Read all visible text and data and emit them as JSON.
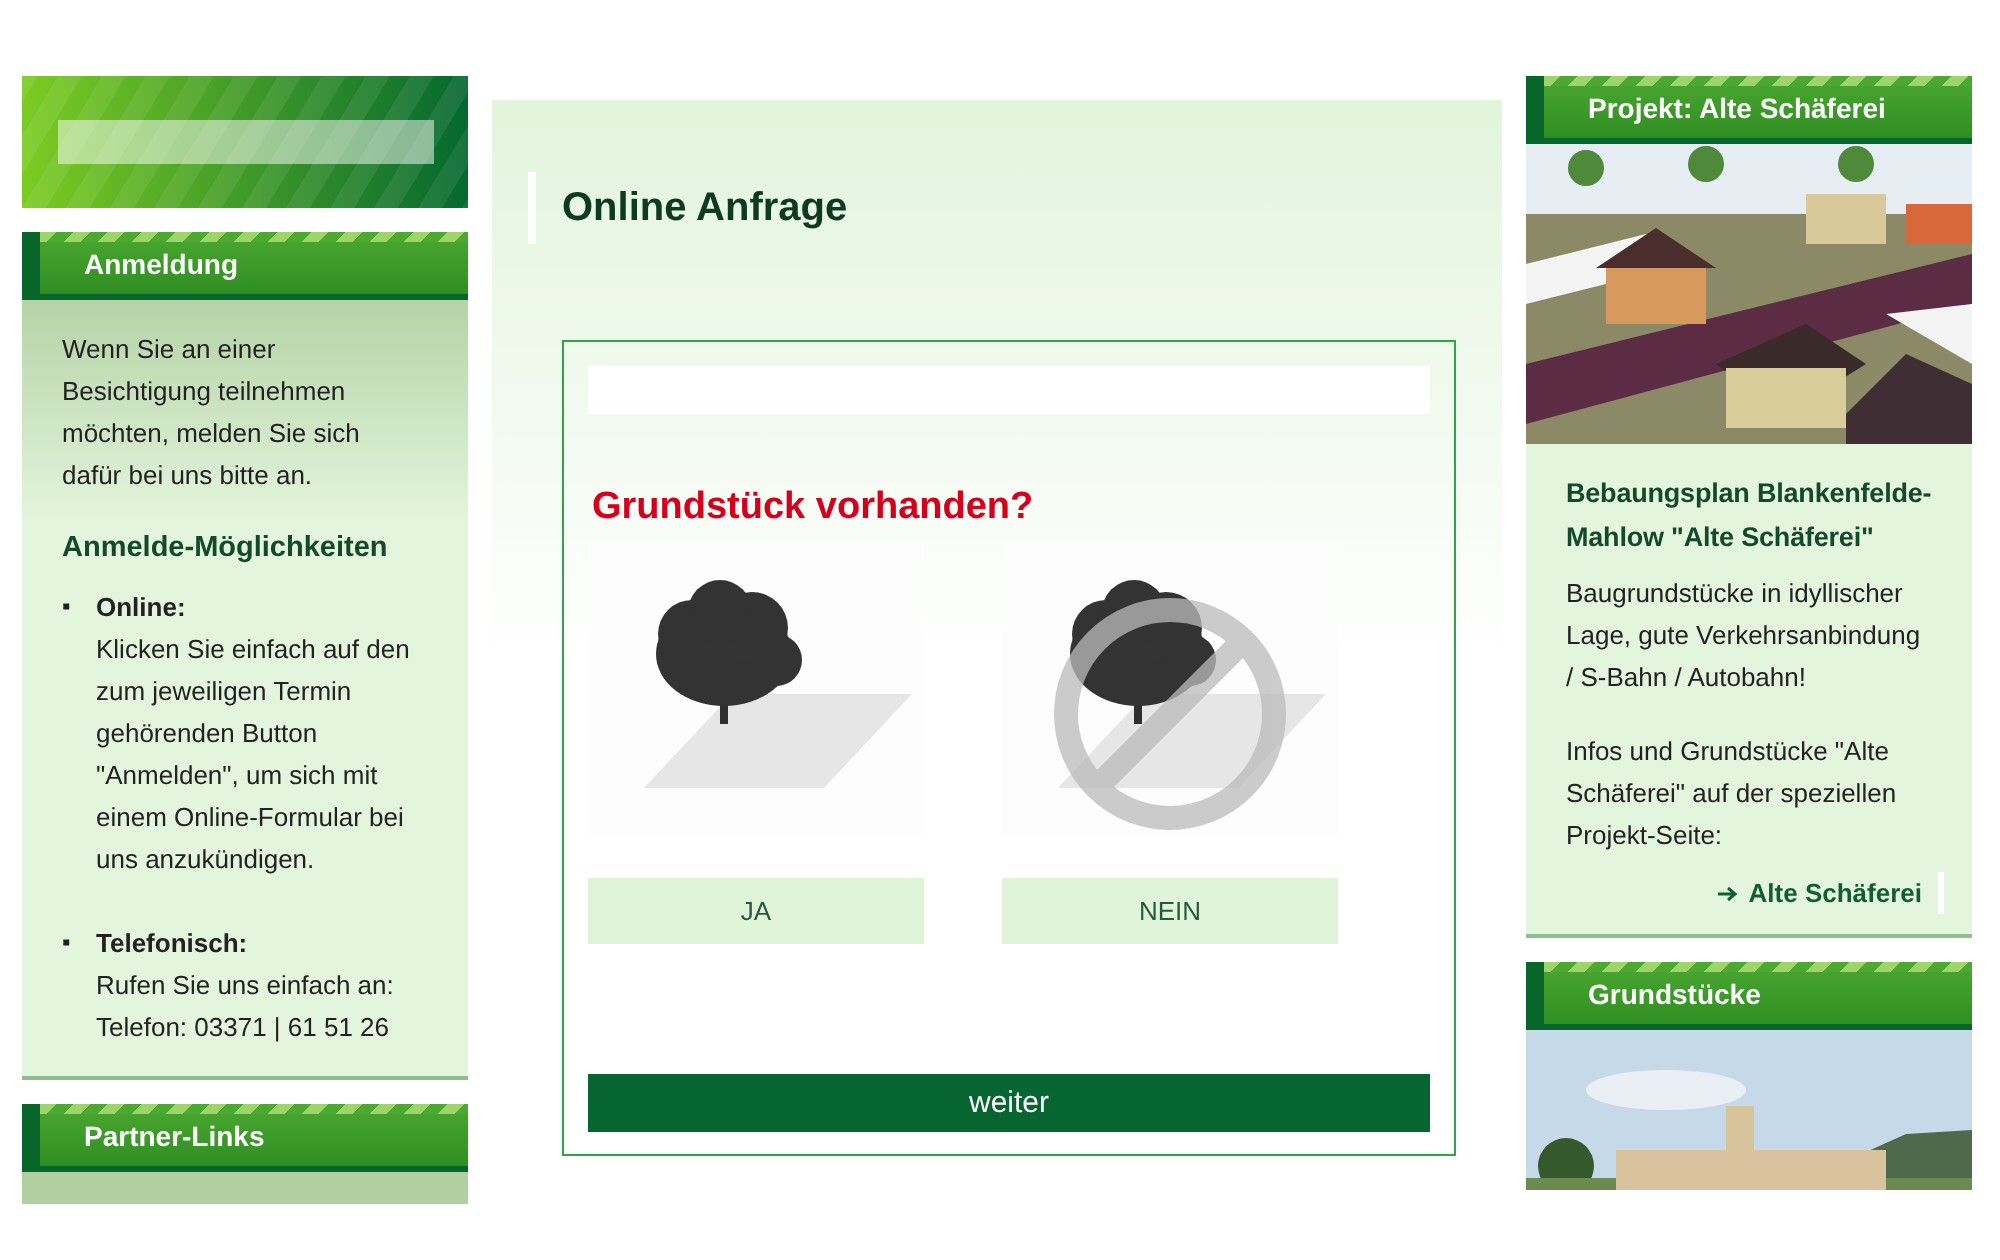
{
  "left_panels": [
    {
      "title": "Anmeldung",
      "intro": "Wenn Sie an einer Besichtigung teilnehmen möchten, melden Sie sich dafür bei uns bitte an.",
      "subheading": "Anmelde-Möglichkeiten",
      "options": [
        {
          "marker": "▪",
          "label": "Online:",
          "text": "Klicken Sie einfach auf den zum jeweiligen Termin gehörenden Button \"Anmelden\", um sich mit einem Online-Formular bei uns anzukündigen."
        },
        {
          "marker": "▪",
          "label": "Telefonisch:",
          "text": "Rufen Sie uns einfach an: Telefon: 03371 | 61 51 26"
        }
      ]
    },
    {
      "title": "Partner-Links"
    }
  ],
  "main": {
    "title": "Online Anfrage",
    "form": {
      "question": "Grundstück vorhanden?",
      "choices": [
        {
          "kind": "yes",
          "label": "JA"
        },
        {
          "kind": "no",
          "label": "NEIN"
        }
      ],
      "submit": "weiter"
    }
  },
  "right_panels": [
    {
      "title": "Projekt: Alte Schäferei",
      "heading": "Bebaungsplan Blankenfelde-Mahlow \"Alte Schäferei\"",
      "text": "Baugrundstücke in idyllischer Lage, gute Verkehrsanbindung / S-Bahn / Autobahn!",
      "text2": "Infos und Grundstücke \"Alte Schäferei\" auf der speziellen Projekt-Seite:",
      "link": "Alte Schäferei"
    },
    {
      "title": "Grundstücke"
    }
  ]
}
